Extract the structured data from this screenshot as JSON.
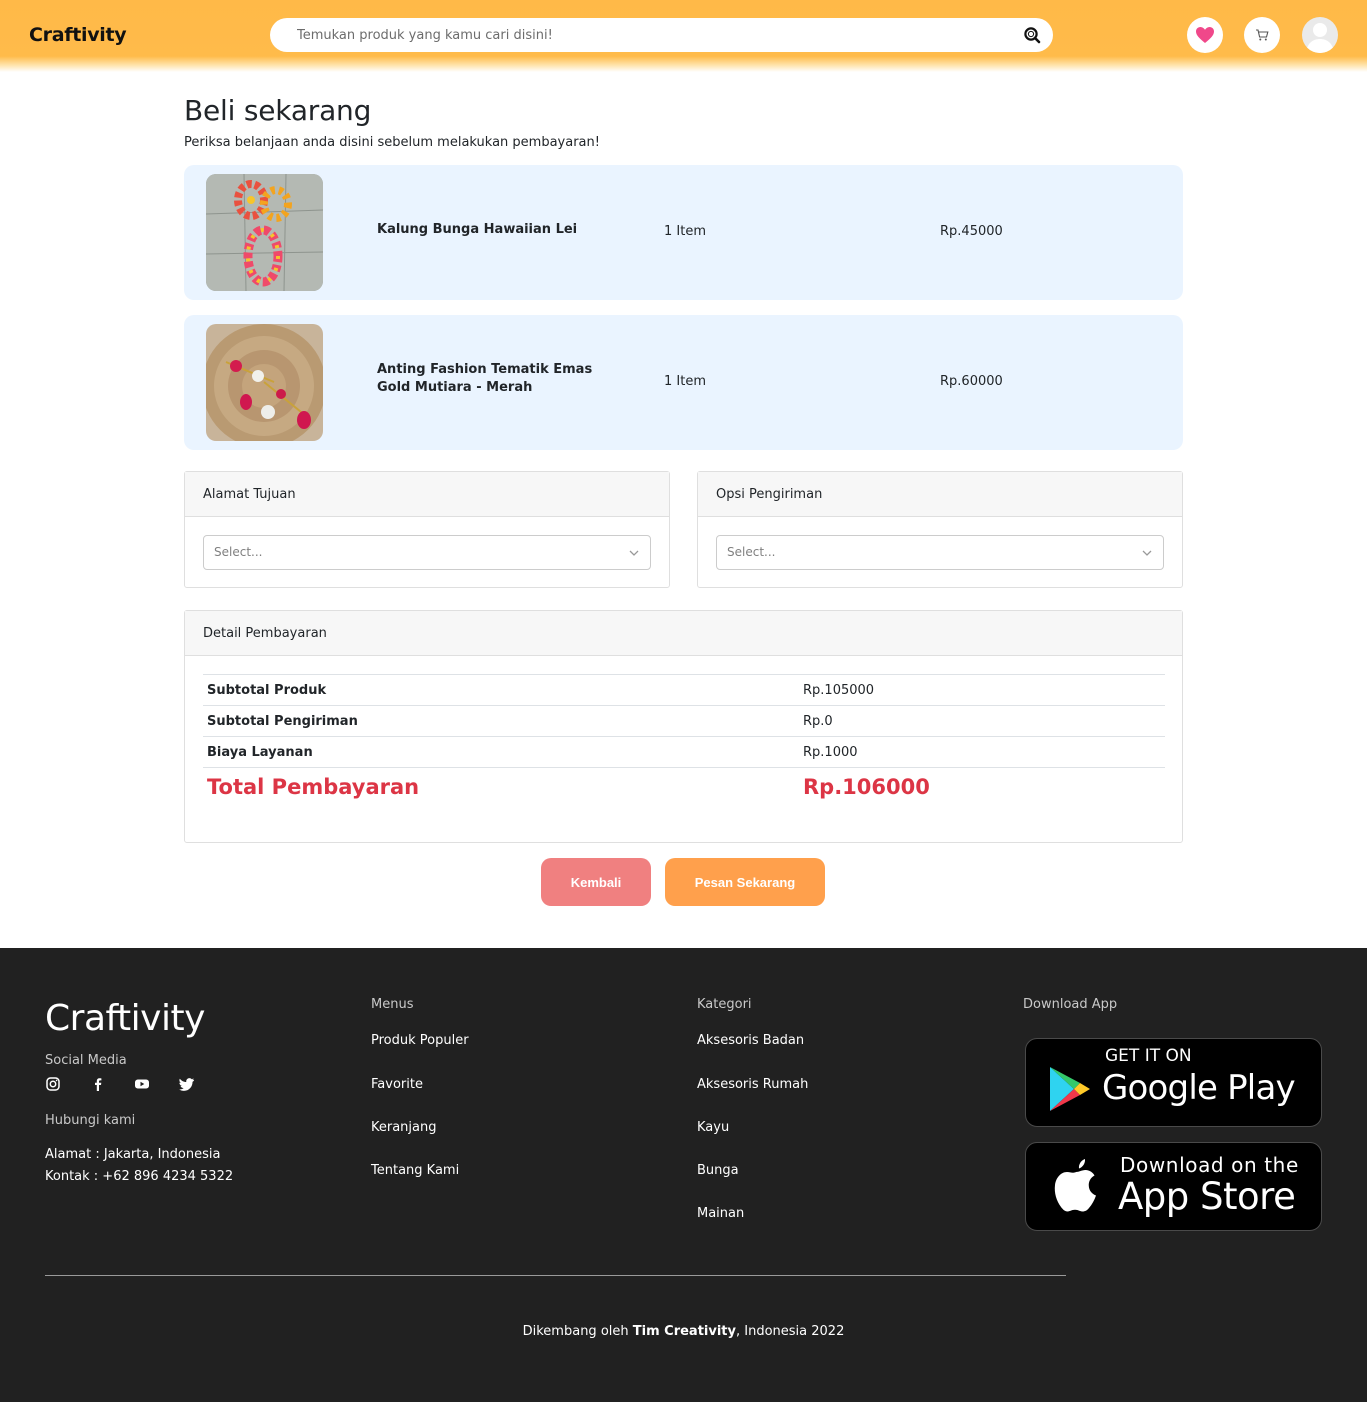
{
  "header": {
    "brand": "Craftivity",
    "search_placeholder": "Temukan produk yang kamu cari disini!"
  },
  "main": {
    "title": "Beli sekarang",
    "subtitle": "Periksa belanjaan anda disini sebelum melakukan pembayaran!",
    "products": [
      {
        "name": "Kalung Bunga Hawaiian Lei",
        "qty": "1 Item",
        "price": "Rp.45000"
      },
      {
        "name": "Anting Fashion Tematik Emas Gold Mutiara - Merah",
        "qty": "1 Item",
        "price": "Rp.60000"
      }
    ],
    "address": {
      "label": "Alamat Tujuan",
      "placeholder": "Select..."
    },
    "shipping": {
      "label": "Opsi Pengiriman",
      "placeholder": "Select..."
    },
    "payment": {
      "label": "Detail Pembayaran",
      "rows": [
        {
          "label": "Subtotal Produk",
          "value": "Rp.105000"
        },
        {
          "label": "Subtotal Pengiriman",
          "value": "Rp.0"
        },
        {
          "label": "Biaya Layanan",
          "value": "Rp.1000"
        }
      ],
      "total_label": "Total Pembayaran",
      "total_value": "Rp.106000",
      "total_color": "#dc3545"
    },
    "back_button": "Kembali",
    "order_button": "Pesan Sekarang"
  },
  "footer": {
    "brand": "Craftivity",
    "social_heading": "Social Media",
    "social_icons": [
      "instagram-icon",
      "facebook-icon",
      "youtube-icon",
      "twitter-icon"
    ],
    "contact_heading": "Hubungi kami",
    "address": "Alamat : Jakarta, Indonesia",
    "contact": "Kontak : +62 896 4234 5322",
    "menus_heading": "Menus",
    "menus": [
      "Produk Populer",
      "Favorite",
      "Keranjang",
      "Tentang Kami"
    ],
    "categories_heading": "Kategori",
    "categories": [
      "Aksesoris Badan",
      "Aksesoris Rumah",
      "Kayu",
      "Bunga",
      "Mainan"
    ],
    "download_heading": "Download App",
    "google_play": {
      "small": "GET IT ON",
      "big": "Google Play"
    },
    "app_store": {
      "small": "Download on the",
      "big": "App Store"
    },
    "credit_prefix": "Dikembang oleh ",
    "credit_team": "Tim Creativity",
    "credit_suffix": ", Indonesia 2022"
  },
  "colors": {
    "header": "#ffb948",
    "product_bg": "#eaf4ff",
    "back_button": "#f08080",
    "order_button": "#ffa04c",
    "footer_bg": "#212121",
    "favorite_icon": "#f0488a"
  }
}
